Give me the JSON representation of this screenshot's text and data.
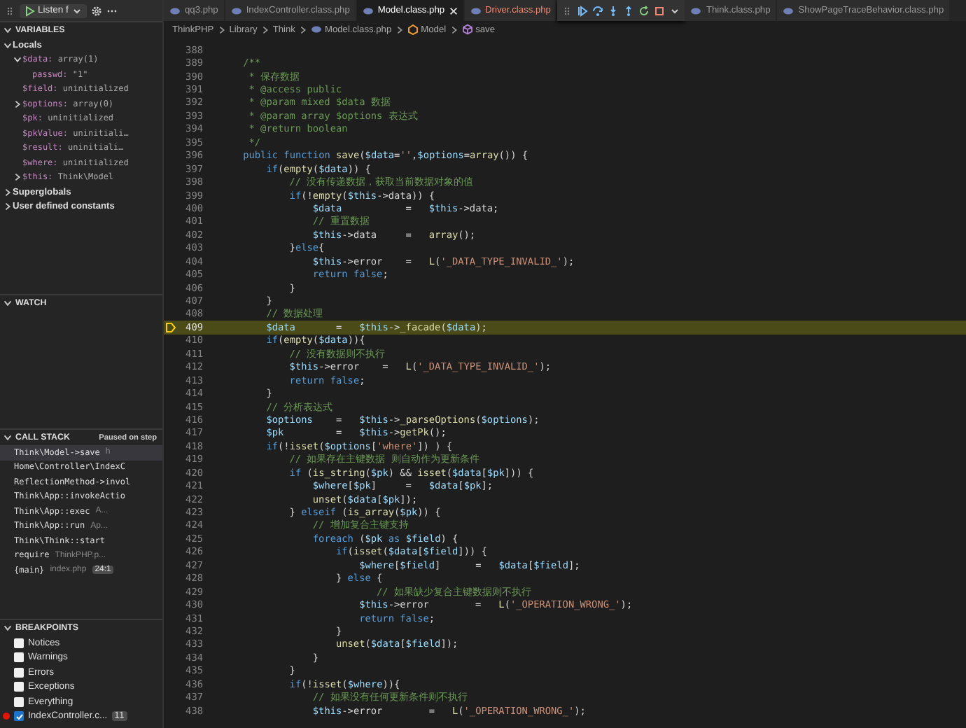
{
  "toolbar": {
    "config": "Listen f"
  },
  "variables": {
    "title": "VARIABLES",
    "expanded": true,
    "scopes": [
      {
        "name": "Locals",
        "expanded": true,
        "children": [
          {
            "name": "$data:",
            "value": "array(1)",
            "expanded": true,
            "children": [
              {
                "name": "passwd:",
                "value": "\"1\""
              }
            ]
          },
          {
            "name": "$field:",
            "value": "uninitialized"
          },
          {
            "name": "$options:",
            "value": "array(0)",
            "expanded": false
          },
          {
            "name": "$pk:",
            "value": "uninitialized"
          },
          {
            "name": "$pkValue:",
            "value": "uninitiali…"
          },
          {
            "name": "$result:",
            "value": "uninitiali…"
          },
          {
            "name": "$where:",
            "value": "uninitialized"
          },
          {
            "name": "$this:",
            "value": "Think\\Model",
            "expanded": false
          }
        ]
      },
      {
        "name": "Superglobals",
        "expanded": false
      },
      {
        "name": "User defined constants",
        "expanded": false
      }
    ]
  },
  "watch": {
    "title": "WATCH",
    "expanded": true
  },
  "call_stack": {
    "title": "CALL STACK",
    "expanded": true,
    "status": "Paused on step",
    "frames": [
      {
        "function": "Think\\Model->save",
        "source": "h",
        "selected": true
      },
      {
        "function": "Home\\Controller\\IndexC",
        "selected": false
      },
      {
        "function": "ReflectionMethod->invol",
        "selected": false
      },
      {
        "function": "Think\\App::invokeActio",
        "selected": false
      },
      {
        "function": "Think\\App::exec",
        "source": "A...",
        "selected": false
      },
      {
        "function": "Think\\App::run",
        "source": "Ap...",
        "selected": false
      },
      {
        "function": "Think\\Think::start",
        "selected": false
      },
      {
        "function": "require",
        "source": "ThinkPHP.p...",
        "selected": false
      },
      {
        "function": "{main}",
        "source": "index.php",
        "line": "24:1",
        "selected": false
      }
    ]
  },
  "breakpoints": {
    "title": "BREAKPOINTS",
    "expanded": true,
    "items": [
      {
        "kind": "exception",
        "label": "Notices",
        "checked": false
      },
      {
        "kind": "exception",
        "label": "Warnings",
        "checked": false
      },
      {
        "kind": "exception",
        "label": "Errors",
        "checked": false
      },
      {
        "kind": "exception",
        "label": "Exceptions",
        "checked": false
      },
      {
        "kind": "exception",
        "label": "Everything",
        "checked": false
      },
      {
        "kind": "file",
        "label": "IndexController.c...",
        "line": "11",
        "checked": true
      }
    ]
  },
  "tabs": [
    {
      "label": "qq3.php",
      "selected": false,
      "has_problems": false
    },
    {
      "label": "IndexController.class.php",
      "selected": false,
      "has_problems": false
    },
    {
      "label": "Model.class.php",
      "selected": true,
      "has_problems": false
    },
    {
      "label": "Driver.class.php",
      "selected": false,
      "has_problems": true
    },
    {
      "label": "Think.class.php",
      "selected": false,
      "has_problems": false
    },
    {
      "label": "ShowPageTraceBehavior.class.php",
      "selected": false,
      "has_problems": false
    }
  ],
  "breadcrumb": [
    {
      "label": "ThinkPHP",
      "kind": "folder"
    },
    {
      "label": "Library",
      "kind": "folder"
    },
    {
      "label": "Think",
      "kind": "folder"
    },
    {
      "label": "Model.class.php",
      "kind": "file"
    },
    {
      "label": "Model",
      "kind": "class"
    },
    {
      "label": "save",
      "kind": "method"
    }
  ],
  "editor": {
    "lines": [
      {
        "number": "388",
        "current": false
      },
      {
        "number": "389",
        "kind": "comment",
        "text": "    /**",
        "current": false
      },
      {
        "number": "390",
        "kind": "comment",
        "text": "     * 保存数据",
        "current": false
      },
      {
        "number": "391",
        "kind": "comment",
        "text": "     * @access public",
        "current": false
      },
      {
        "number": "392",
        "kind": "comment",
        "text": "     * @param mixed $data 数据",
        "current": false
      },
      {
        "number": "393",
        "kind": "comment",
        "text": "     * @param array $options 表达式",
        "current": false
      },
      {
        "number": "394",
        "kind": "comment",
        "text": "     * @return boolean",
        "current": false
      },
      {
        "number": "395",
        "kind": "comment",
        "text": "     */",
        "current": false
      },
      {
        "number": "396",
        "kind": "code",
        "text": "    public function save($data='',$options=array()) {",
        "current": false
      },
      {
        "number": "397",
        "kind": "code",
        "text": "        if(empty($data)) {",
        "current": false
      },
      {
        "number": "398",
        "kind": "comment",
        "text": "            // 没有传递数据，获取当前数据对象的值",
        "current": false
      },
      {
        "number": "399",
        "kind": "code",
        "text": "            if(!empty($this->data)) {",
        "current": false
      },
      {
        "number": "400",
        "kind": "code",
        "text": "                $data           =   $this->data;",
        "current": false
      },
      {
        "number": "401",
        "kind": "comment",
        "text": "                // 重置数据",
        "current": false
      },
      {
        "number": "402",
        "kind": "code",
        "text": "                $this->data     =   array();",
        "current": false
      },
      {
        "number": "403",
        "kind": "code",
        "text": "            }else{",
        "current": false
      },
      {
        "number": "404",
        "kind": "code",
        "text": "                $this->error    =   L('_DATA_TYPE_INVALID_');",
        "current": false
      },
      {
        "number": "405",
        "kind": "code",
        "text": "                return false;",
        "current": false
      },
      {
        "number": "406",
        "kind": "code",
        "text": "            }",
        "current": false
      },
      {
        "number": "407",
        "kind": "code",
        "text": "        }",
        "current": false
      },
      {
        "number": "408",
        "kind": "comment",
        "text": "        // 数据处理",
        "current": false
      },
      {
        "number": "409",
        "kind": "code",
        "text": "        $data       =   $this->_facade($data);",
        "current": true
      },
      {
        "number": "410",
        "kind": "code",
        "text": "        if(empty($data)){",
        "current": false
      },
      {
        "number": "411",
        "kind": "comment",
        "text": "            // 没有数据则不执行",
        "current": false
      },
      {
        "number": "412",
        "kind": "code",
        "text": "            $this->error    =   L('_DATA_TYPE_INVALID_');",
        "current": false
      },
      {
        "number": "413",
        "kind": "code",
        "text": "            return false;",
        "current": false
      },
      {
        "number": "414",
        "kind": "code",
        "text": "        }",
        "current": false
      },
      {
        "number": "415",
        "kind": "comment",
        "text": "        // 分析表达式",
        "current": false
      },
      {
        "number": "416",
        "kind": "code",
        "text": "        $options    =   $this->_parseOptions($options);",
        "current": false
      },
      {
        "number": "417",
        "kind": "code",
        "text": "        $pk         =   $this->getPk();",
        "current": false
      },
      {
        "number": "418",
        "kind": "code",
        "text": "        if(!isset($options['where']) ) {",
        "current": false
      },
      {
        "number": "419",
        "kind": "comment",
        "text": "            // 如果存在主键数据 则自动作为更新条件",
        "current": false
      },
      {
        "number": "420",
        "kind": "code",
        "text": "            if (is_string($pk) && isset($data[$pk])) {",
        "current": false
      },
      {
        "number": "421",
        "kind": "code",
        "text": "                $where[$pk]     =   $data[$pk];",
        "current": false
      },
      {
        "number": "422",
        "kind": "code",
        "text": "                unset($data[$pk]);",
        "current": false
      },
      {
        "number": "423",
        "kind": "code",
        "text": "            } elseif (is_array($pk)) {",
        "current": false
      },
      {
        "number": "424",
        "kind": "comment",
        "text": "                // 增加复合主键支持",
        "current": false
      },
      {
        "number": "425",
        "kind": "code",
        "text": "                foreach ($pk as $field) {",
        "current": false
      },
      {
        "number": "426",
        "kind": "code",
        "text": "                    if(isset($data[$field])) {",
        "current": false
      },
      {
        "number": "427",
        "kind": "code",
        "text": "                        $where[$field]      =   $data[$field];",
        "current": false
      },
      {
        "number": "428",
        "kind": "code",
        "text": "                    } else {",
        "current": false
      },
      {
        "number": "429",
        "kind": "comment",
        "text": "                           // 如果缺少复合主键数据则不执行",
        "current": false
      },
      {
        "number": "430",
        "kind": "code",
        "text": "                        $this->error        =   L('_OPERATION_WRONG_');",
        "current": false
      },
      {
        "number": "431",
        "kind": "code",
        "text": "                        return false;",
        "current": false
      },
      {
        "number": "432",
        "kind": "code",
        "text": "                    }",
        "current": false
      },
      {
        "number": "433",
        "kind": "code",
        "text": "                    unset($data[$field]);",
        "current": false
      },
      {
        "number": "434",
        "kind": "code",
        "text": "                }",
        "current": false
      },
      {
        "number": "435",
        "kind": "code",
        "text": "            }",
        "current": false
      },
      {
        "number": "436",
        "kind": "code",
        "text": "            if(!isset($where)){",
        "current": false
      },
      {
        "number": "437",
        "kind": "comment",
        "text": "                // 如果没有任何更新条件则不执行",
        "current": false
      },
      {
        "number": "438",
        "kind": "code",
        "text": "                $this->error        =   L('_OPERATION_WRONG_');",
        "current": false
      }
    ]
  }
}
